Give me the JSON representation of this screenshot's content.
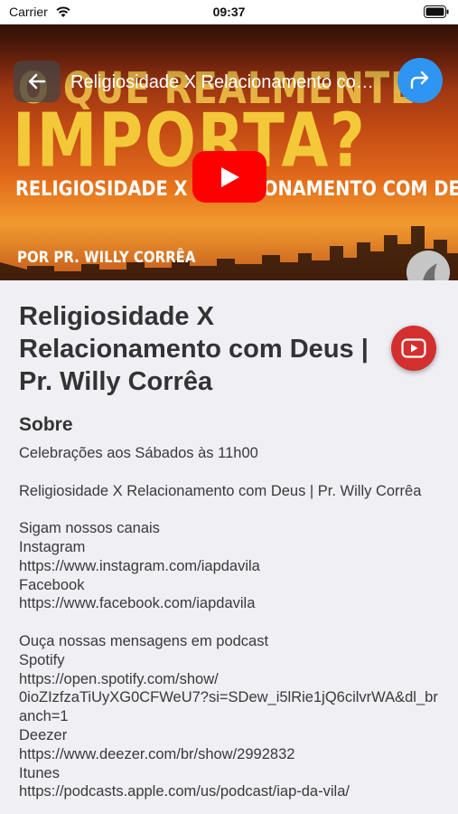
{
  "status_bar": {
    "carrier": "Carrier",
    "time": "09:37"
  },
  "video": {
    "title": "Religiosidade X Relacionamento com Deus | Pr. Willy Corrêa",
    "thumbnail_text": {
      "line1": "O QUE REALMENTE",
      "line2": "IMPORTA?",
      "line3": "RELIGIOSIDADE X RELACIONAMENTO COM DEUS",
      "line4": "POR PR. WILLY CORRÊA"
    },
    "play_color": "#ff0000",
    "share_color": "#2f95f3"
  },
  "page": {
    "title": "Religiosidade X Relacionamento com Deus | Pr. Willy Corrêa",
    "section_heading": "Sobre",
    "description": "Celebrações aos Sábados às 11h00\n\nReligiosidade X Relacionamento com Deus | Pr. Willy Corrêa\n\nSigam nossos canais\nInstagram\nhttps://www.instagram.com/iapdavila\nFacebook\nhttps://www.facebook.com/iapdavila\n\nOuça nossas mensagens em podcast\nSpotify\nhttps://open.spotify.com/show/\n0ioZIzfzaTiUyXG0CFWeU7?si=SDew_i5lRie1jQ6cilvrWA&dl_branch=1\nDeezer\nhttps://www.deezer.com/br/show/2992832\nItunes\nhttps://podcasts.apple.com/us/podcast/iap-da-vila/",
    "fab_color": "#d32f2f"
  },
  "icons": {
    "back": "arrow-left-icon",
    "share": "share-arrow-icon",
    "play": "play-icon",
    "youtube": "youtube-icon",
    "wifi": "wifi-icon",
    "battery": "battery-icon"
  }
}
